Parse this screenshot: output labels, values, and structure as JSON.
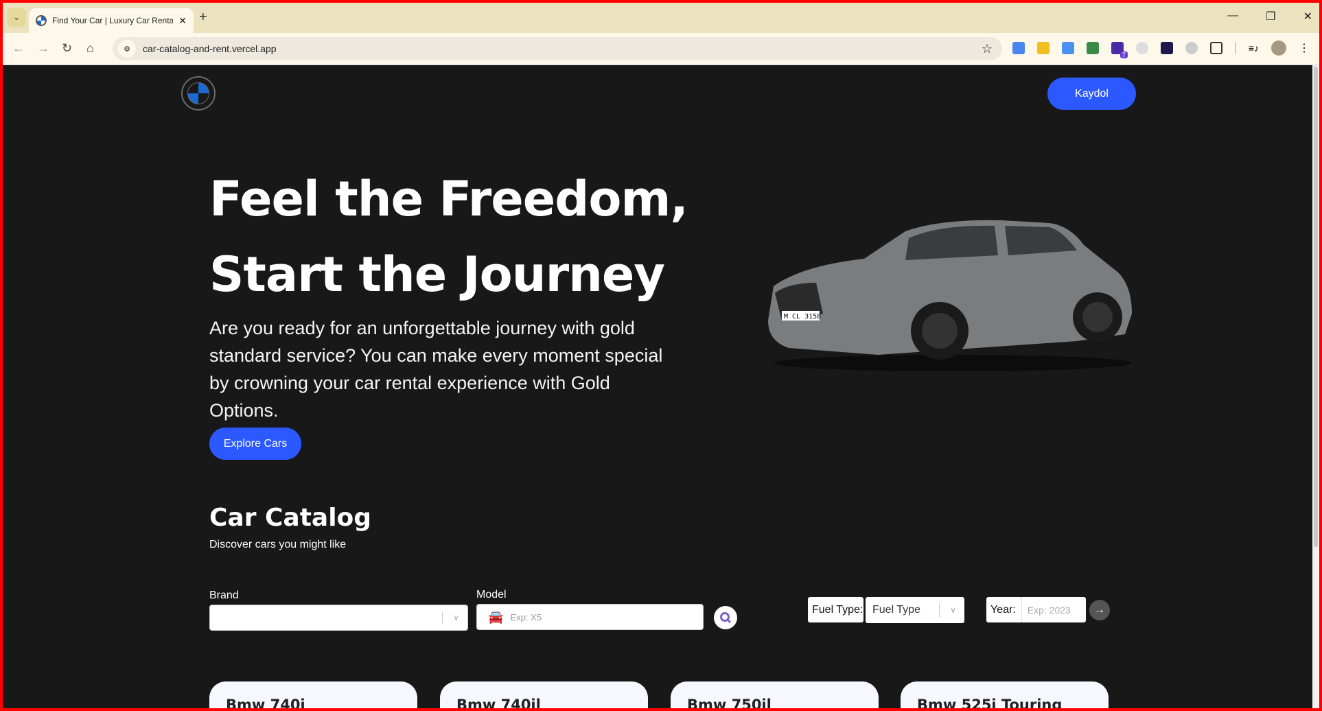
{
  "browser": {
    "tab_title": "Find Your Car | Luxury Car Renta",
    "url": "car-catalog-and-rent.vercel.app",
    "extension_badge": "7"
  },
  "header": {
    "logo_text": "BMW",
    "signup_label": "Kaydol"
  },
  "hero": {
    "title_line1": "Feel the Freedom,",
    "title_line2": "Start the Journey",
    "description": "Are you ready for an unforgettable journey with gold standard service? You can make every moment special by crowning your car rental experience with Gold Options.",
    "cta_label": "Explore Cars",
    "car_plate": "M CL 3158"
  },
  "catalog": {
    "title": "Car Catalog",
    "subtitle": "Discover cars you might like",
    "brand_label": "Brand",
    "brand_value": "",
    "model_label": "Model",
    "model_placeholder": "Exp: X5",
    "fuel_label": "Fuel Type:",
    "fuel_value": "Fuel Type",
    "year_label": "Year:",
    "year_placeholder": "Exp: 2023",
    "cards": [
      {
        "title": "Bmw 740i"
      },
      {
        "title": "Bmw 740il"
      },
      {
        "title": "Bmw 750il"
      },
      {
        "title": "Bmw 525i Touring"
      }
    ]
  },
  "colors": {
    "accent": "#2b59ff",
    "background": "#181818",
    "card": "#f5f8fe"
  }
}
